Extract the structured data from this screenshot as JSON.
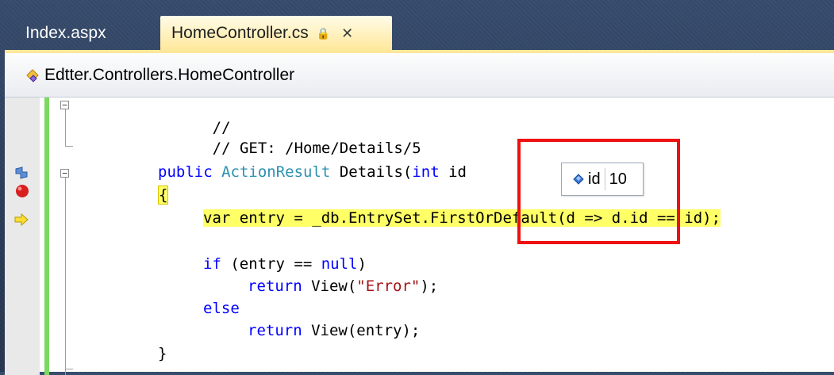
{
  "tabs": [
    {
      "label": "Index.aspx",
      "active": false
    },
    {
      "label": "HomeController.cs",
      "active": true,
      "lock_glyph": "🔒",
      "close_glyph": "✕"
    }
  ],
  "navbar": {
    "class_label": "Edtter.Controllers.HomeController"
  },
  "code_lines": [
    {
      "comment": "//"
    },
    {
      "comment": "// GET: /Home/Details/5"
    },
    {
      "kw_public": "public",
      "type": "ActionResult",
      "name": " Details(",
      "kw_int": "int",
      "param": " id"
    },
    {
      "brace": "{"
    },
    {
      "text": "var entry = _db.EntrySet.FirstOrDefault(d => d.id == id);"
    },
    {
      "kw_if": "if",
      "text_a": " (entry == ",
      "kw_null": "null",
      "text_b": ")"
    },
    {
      "kw_return": "return",
      "text_a": " View(",
      "str": "\"Error\"",
      "text_b": ");"
    },
    {
      "kw_else": "else"
    },
    {
      "kw_return": "return",
      "text": " View(entry);"
    },
    {
      "brace": "}"
    }
  ],
  "datatip": {
    "name": "id",
    "value": "10"
  },
  "colors": {
    "highlight": "#ffff66",
    "keyword": "#0000ff",
    "type": "#2b91af",
    "string": "#a31515",
    "callout": "#ee1111"
  }
}
